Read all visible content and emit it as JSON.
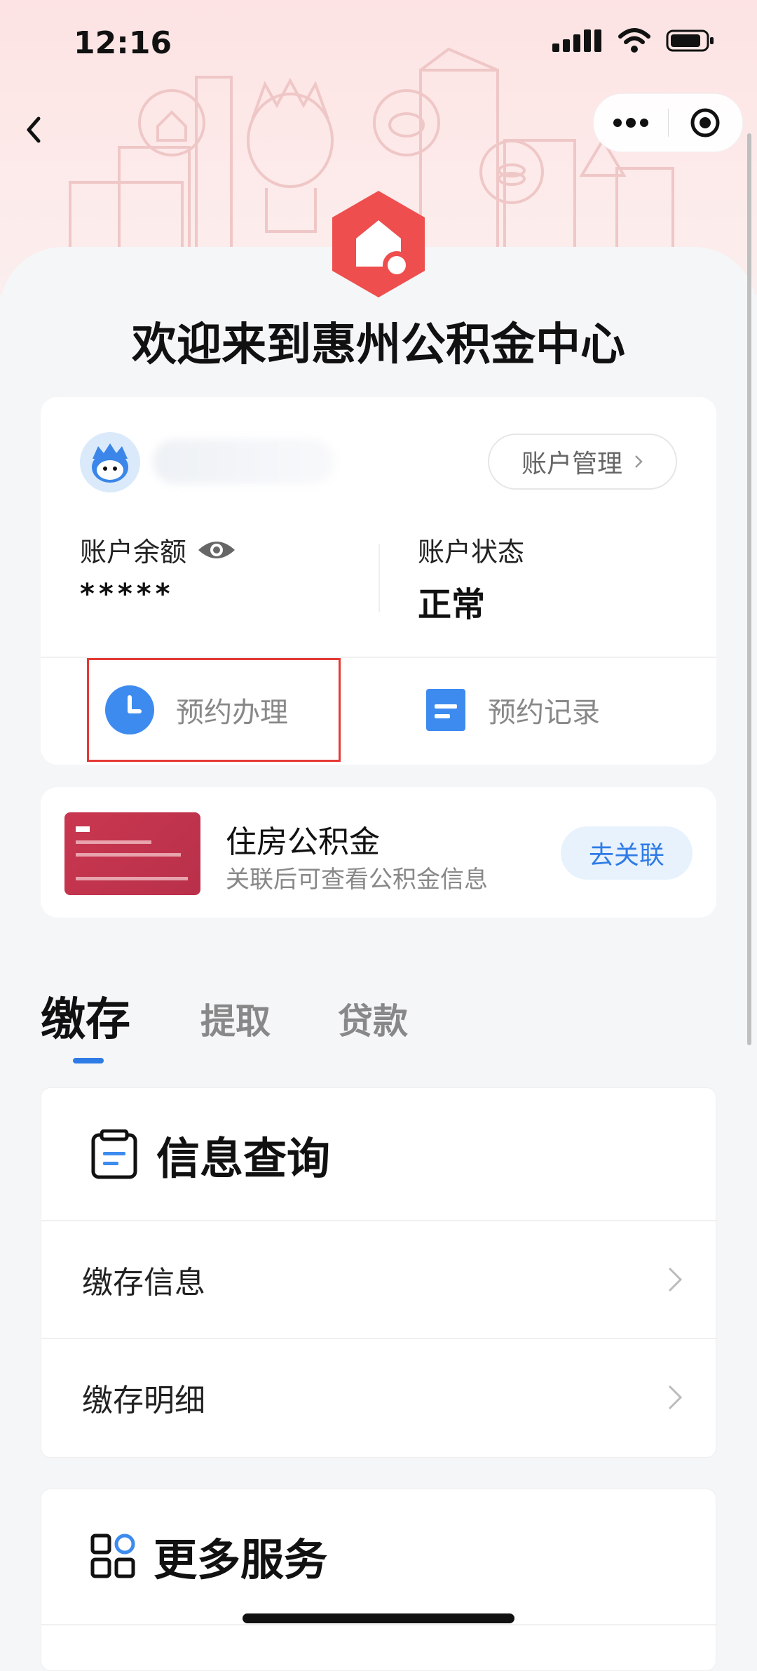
{
  "status_bar": {
    "time": "12:16"
  },
  "header": {
    "title": "欢迎来到惠州公积金中心"
  },
  "account": {
    "manage_label": "账户管理",
    "balance_label": "账户余额",
    "balance_value": "*****",
    "status_label": "账户状态",
    "status_value": "正常",
    "appointment_label": "预约办理",
    "records_label": "预约记录"
  },
  "fund": {
    "title": "住房公积金",
    "subtitle": "关联后可查看公积金信息",
    "link_label": "去关联"
  },
  "tabs": [
    {
      "label": "缴存",
      "active": true
    },
    {
      "label": "提取",
      "active": false
    },
    {
      "label": "贷款",
      "active": false
    }
  ],
  "info_section": {
    "title": "信息查询",
    "items": [
      {
        "label": "缴存信息"
      },
      {
        "label": "缴存明细"
      }
    ]
  },
  "more_section": {
    "title": "更多服务"
  },
  "colors": {
    "accent": "#2f7be6",
    "brand_red": "#ee4e4e",
    "highlight": "#e53935",
    "hero_bg": "#fde3e3"
  }
}
